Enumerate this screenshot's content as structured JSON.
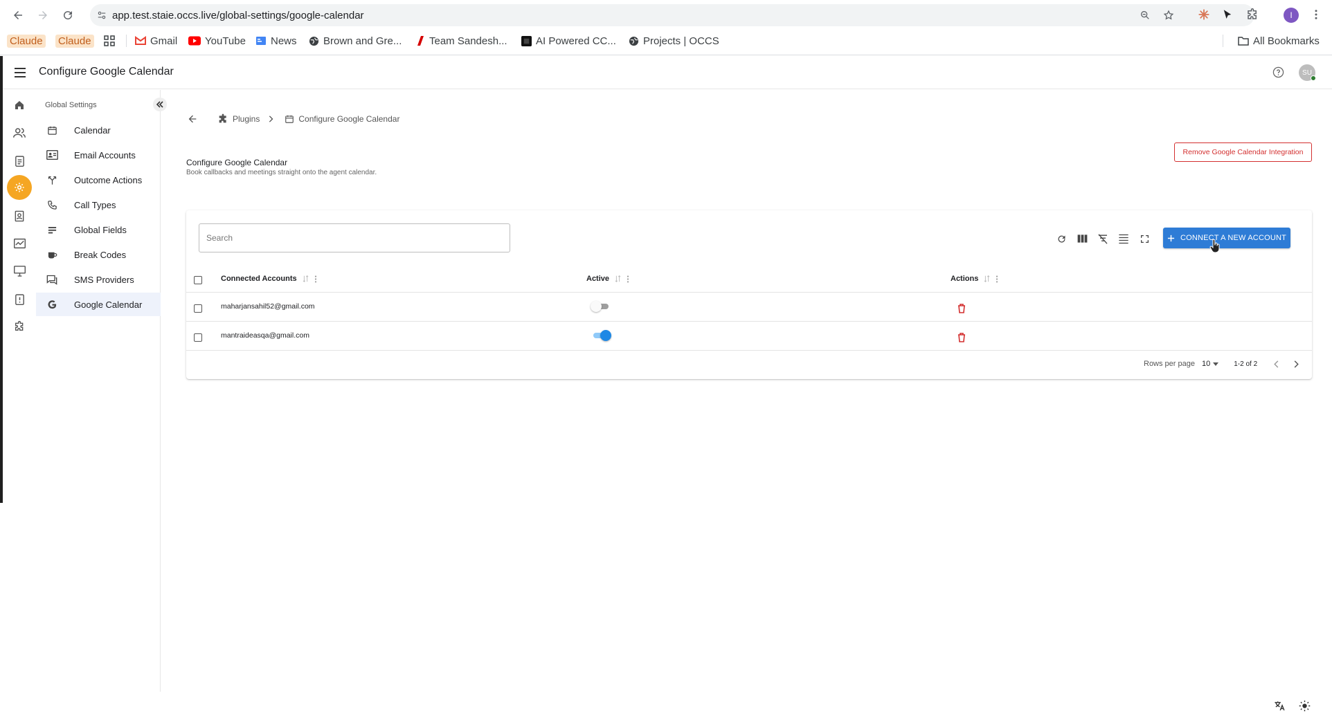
{
  "browser": {
    "url": "app.test.staie.occs.live/global-settings/google-calendar",
    "bookmarks": [
      {
        "label": "Claude",
        "icon": "claude-tag"
      },
      {
        "label": "Claude",
        "icon": "claude-tag"
      },
      {
        "label": "",
        "icon": "apps-grid-icon"
      },
      {
        "label": "Gmail",
        "icon": "gmail-icon"
      },
      {
        "label": "YouTube",
        "icon": "youtube-icon"
      },
      {
        "label": "News",
        "icon": "news-icon"
      },
      {
        "label": "Brown and Gre...",
        "icon": "globe-icon"
      },
      {
        "label": "Team Sandesh...",
        "icon": "team-icon"
      },
      {
        "label": "AI Powered CC...",
        "icon": "ai-icon"
      },
      {
        "label": "Projects | OCCS",
        "icon": "globe-icon"
      }
    ],
    "all_bookmarks": "All Bookmarks",
    "profile_initial": "I"
  },
  "app": {
    "title": "Configure Google Calendar",
    "avatar_initials": "SU"
  },
  "sidebar": {
    "header": "Global Settings",
    "items": [
      {
        "label": "Calendar",
        "icon": "calendar-icon"
      },
      {
        "label": "Email Accounts",
        "icon": "email-accounts-icon"
      },
      {
        "label": "Outcome Actions",
        "icon": "outcome-icon"
      },
      {
        "label": "Call Types",
        "icon": "phone-icon"
      },
      {
        "label": "Global Fields",
        "icon": "fields-icon"
      },
      {
        "label": "Break Codes",
        "icon": "coffee-icon"
      },
      {
        "label": "SMS Providers",
        "icon": "sms-icon"
      },
      {
        "label": "Google Calendar",
        "icon": "google-icon"
      }
    ],
    "active_index": 7
  },
  "breadcrumb": {
    "parent": "Plugins",
    "current": "Configure Google Calendar"
  },
  "section": {
    "title": "Configure Google Calendar",
    "subtitle": "Book callbacks and meetings straight onto the agent calendar.",
    "remove_label": "Remove Google Calendar Integration"
  },
  "table": {
    "search_placeholder": "Search",
    "connect_label": "CONNECT A NEW ACCOUNT",
    "columns": [
      "Connected Accounts",
      "Active",
      "Actions"
    ],
    "rows": [
      {
        "email": "maharjansahil52@gmail.com",
        "active": false
      },
      {
        "email": "mantraideasqa@gmail.com",
        "active": true
      }
    ],
    "rows_per_page_label": "Rows per page",
    "rows_per_page": "10",
    "range": "1-2 of 2"
  },
  "colors": {
    "accent": "#2e7cd6",
    "active_rail": "#f5a623",
    "danger": "#d32f2f"
  }
}
